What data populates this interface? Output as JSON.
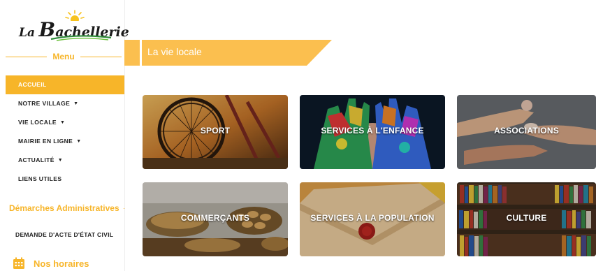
{
  "logo": {
    "part1": "La",
    "part2": "B",
    "part3": "achellerie"
  },
  "sidebar": {
    "menu_title": "Menu",
    "items": [
      {
        "label": "ACCUEIL",
        "dropdown": false,
        "active": true
      },
      {
        "label": "NOTRE VILLAGE",
        "dropdown": true,
        "active": false
      },
      {
        "label": "VIE LOCALE",
        "dropdown": true,
        "active": false
      },
      {
        "label": "MAIRIE EN LIGNE",
        "dropdown": true,
        "active": false
      },
      {
        "label": "ACTUALITÉ",
        "dropdown": true,
        "active": false
      },
      {
        "label": "LIENS UTILES",
        "dropdown": false,
        "active": false
      }
    ],
    "demarches_title": "Démarches Administratives",
    "demarches_item": "DEMANDE D'ACTE D'ÉTAT CIVIL",
    "horaires": "Nos horaires"
  },
  "banner": {
    "title": "La vie locale"
  },
  "tiles": [
    {
      "label": "SPORT",
      "icon": "bicycle-wheel-photo"
    },
    {
      "label": "SERVICES À L'ENFANCE",
      "icon": "painted-hands-photo"
    },
    {
      "label": "ASSOCIATIONS",
      "icon": "joined-hands-photo"
    },
    {
      "label": "COMMERÇANTS",
      "icon": "bakery-stall-photo"
    },
    {
      "label": "SERVICES À LA POPULATION",
      "icon": "sealed-envelope-photo"
    },
    {
      "label": "CULTURE",
      "icon": "bookshelf-photo"
    }
  ],
  "colors": {
    "accent": "#f7b529",
    "banner": "#fbbf4f",
    "text": "#222222"
  }
}
